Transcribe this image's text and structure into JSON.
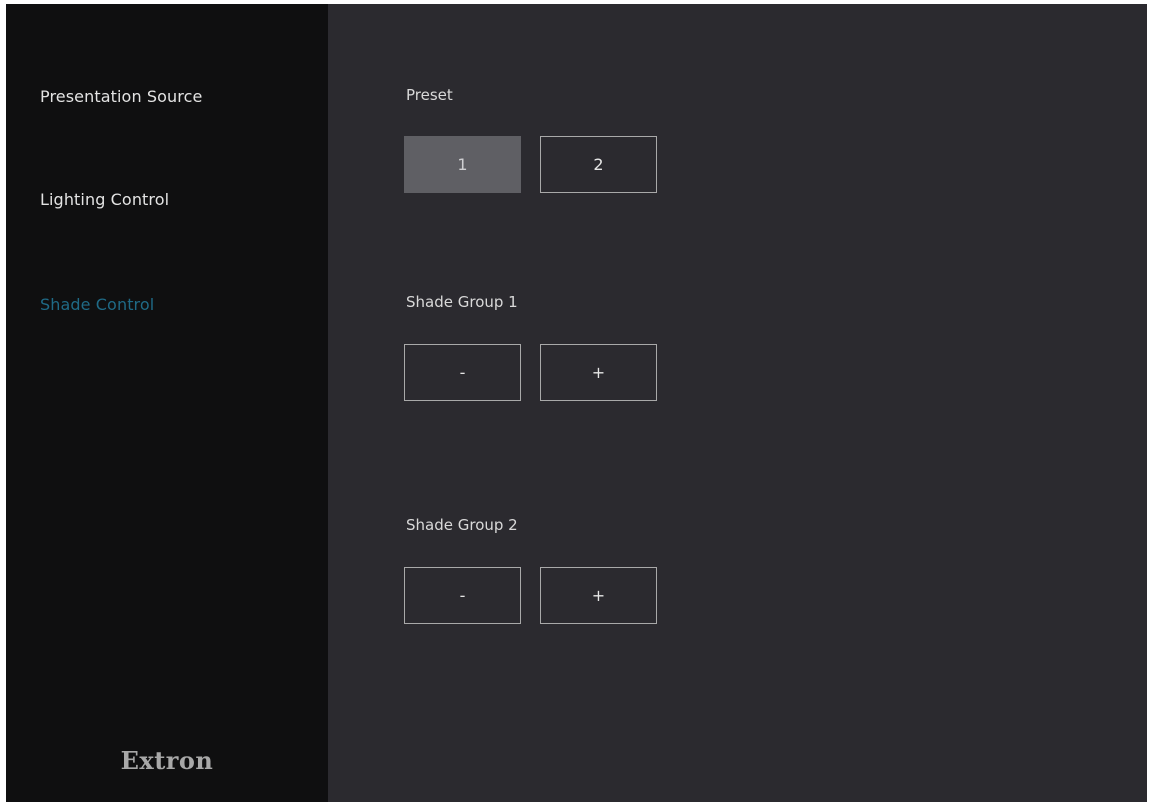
{
  "sidebar": {
    "items": [
      {
        "label": "Presentation Source",
        "active": false
      },
      {
        "label": "Lighting Control",
        "active": false
      },
      {
        "label": "Shade Control",
        "active": true
      }
    ],
    "logo": "Extron"
  },
  "main": {
    "preset": {
      "label": "Preset",
      "buttons": [
        {
          "label": "1",
          "selected": true
        },
        {
          "label": "2",
          "selected": false
        }
      ]
    },
    "shade_group_1": {
      "label": "Shade Group 1",
      "decrease": "-",
      "increase": "+"
    },
    "shade_group_2": {
      "label": "Shade Group 2",
      "decrease": "-",
      "increase": "+"
    }
  },
  "colors": {
    "sidebar_bg": "#0f0f10",
    "main_bg": "#2b2a2f",
    "active_nav": "#1f6a86",
    "selected_button": "#5f5f64",
    "button_border": "#a9a9a9"
  }
}
